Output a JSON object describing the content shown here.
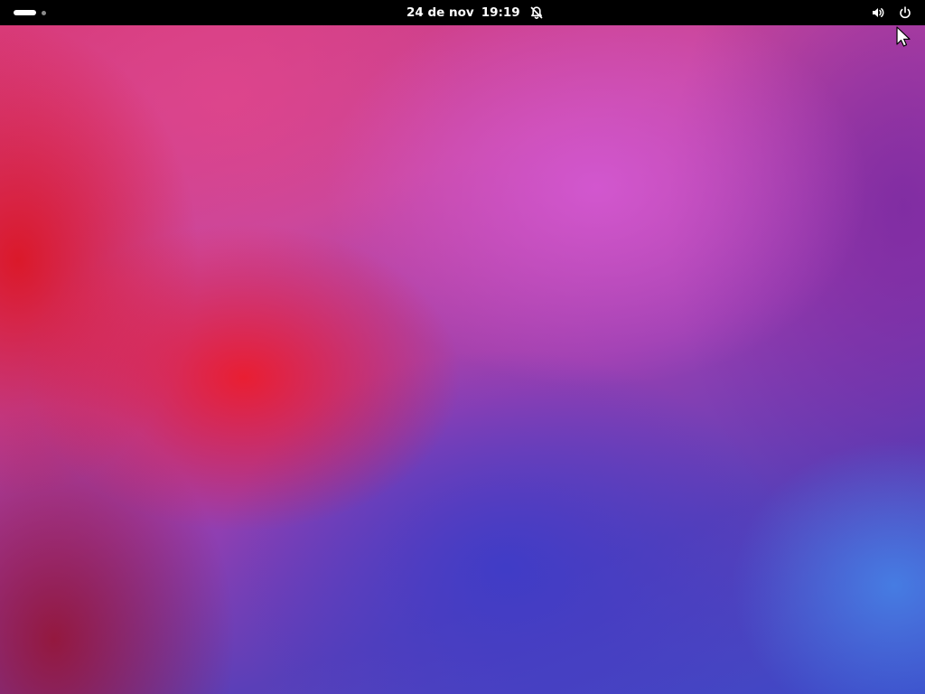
{
  "topbar": {
    "date": "24 de nov",
    "time": "19:19",
    "icons": {
      "notifications": "bell-off-icon",
      "volume": "volume-icon",
      "power": "power-icon"
    },
    "workspaces": {
      "count": 2,
      "active": 1
    }
  },
  "desktop": {
    "wallpaper": "abstract-gradient",
    "colors": {
      "topbar": "#000000",
      "red": "#ec1c2c",
      "pink": "#d65ad6",
      "blue": "#3c3cc8"
    }
  },
  "pointer": {
    "icon": "mouse-pointer-icon"
  }
}
